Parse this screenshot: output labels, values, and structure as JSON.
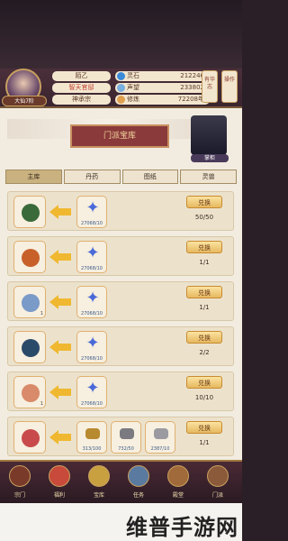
{
  "player": {
    "name": "陌乙",
    "sect": "智天官邸",
    "rank": "神承宗",
    "level": "大仙7阶"
  },
  "stats": [
    {
      "label": "灵石",
      "value": "212246",
      "icon": "spirit-stone-icon",
      "color": "#3a8ad8"
    },
    {
      "label": "声望",
      "value": "233802",
      "icon": "reputation-icon",
      "color": "#7ab0e0"
    },
    {
      "label": "修炼",
      "value": "72208年",
      "icon": "cultivation-icon",
      "color": "#e0a050"
    }
  ],
  "side_buttons": [
    "有华志",
    "操作"
  ],
  "banner": {
    "title": "门派宝库",
    "npc_label": "掌柜"
  },
  "tabs": [
    "主库",
    "丹药",
    "图纸",
    "灵兽"
  ],
  "rows": [
    {
      "item": "lantern-icon",
      "item_color": "#3a6a3a",
      "item_count": "",
      "mats": [
        {
          "count": "27068/10",
          "type": "star"
        }
      ],
      "button": "兑换",
      "limit": "50/50"
    },
    {
      "item": "gourd-icon",
      "item_color": "#c8602a",
      "item_count": "",
      "mats": [
        {
          "count": "27068/10",
          "type": "star"
        }
      ],
      "button": "兑换",
      "limit": "1/1"
    },
    {
      "item": "sword-icon",
      "item_color": "#7a9ac8",
      "item_count": "1",
      "mats": [
        {
          "count": "27068/10",
          "type": "star"
        }
      ],
      "button": "兑换",
      "limit": "1/1"
    },
    {
      "item": "orb-icon",
      "item_color": "#2a4a6a",
      "item_count": "",
      "mats": [
        {
          "count": "27068/10",
          "type": "star"
        }
      ],
      "button": "兑换",
      "limit": "2/2"
    },
    {
      "item": "scroll-icon",
      "item_color": "#d88a6a",
      "item_count": "1",
      "mats": [
        {
          "count": "27068/10",
          "type": "star"
        }
      ],
      "button": "兑换",
      "limit": "10/10"
    },
    {
      "item": "cauldron-icon",
      "item_color": "#c84a4a",
      "item_count": "",
      "mats": [
        {
          "count": "313/100",
          "type": "gold",
          "color": "#b88a30"
        },
        {
          "count": "732/50",
          "type": "silver",
          "color": "#7a7a80"
        },
        {
          "count": "2387/10",
          "type": "silver2",
          "color": "#9a9aa0"
        }
      ],
      "button": "兑换",
      "limit": "1/1"
    }
  ],
  "footer": [
    "宗门",
    "福利",
    "宝库",
    "任务",
    "殿堂",
    "门派"
  ],
  "watermark": "维普手游网"
}
